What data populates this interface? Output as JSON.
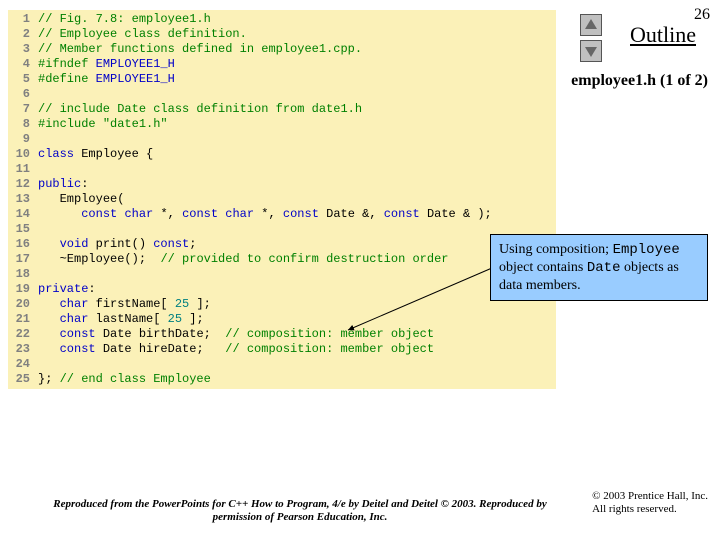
{
  "pageNumber": "26",
  "outline": "Outline",
  "subtitle": "employee1.h (1 of 2)",
  "callout": {
    "t1": "Using composition; ",
    "m1": "Employee",
    "t2": " object contains ",
    "m2": "Date",
    "t3": " objects as data members."
  },
  "copyright": {
    "l1": "© 2003 Prentice Hall, Inc.",
    "l2": "All rights reserved."
  },
  "repro": "Reproduced from the PowerPoints for C++ How to Program, 4/e by Deitel and Deitel © 2003. Reproduced by permission of Pearson Education, Inc.",
  "code": {
    "l1": {
      "n": "1",
      "pad": "",
      "c": "// Fig. 7.8: employee1.h"
    },
    "l2": {
      "n": "2",
      "pad": "",
      "c": "// Employee class definition."
    },
    "l3": {
      "n": "3",
      "pad": "",
      "c": "// Member functions defined in employee1.cpp."
    },
    "l4": {
      "n": "4",
      "pad": "",
      "p1": "#ifndef",
      "sp": " ",
      "id": "EMPLOYEE1_H"
    },
    "l5": {
      "n": "5",
      "pad": "",
      "p1": "#define",
      "sp": " ",
      "id": "EMPLOYEE1_H"
    },
    "l6": {
      "n": "6"
    },
    "l7": {
      "n": "7",
      "pad": "",
      "c": "// include Date class definition from date1.h"
    },
    "l8": {
      "n": "8",
      "pad": "",
      "p1": "#include",
      "sp": " ",
      "s": "\"date1.h\""
    },
    "l9": {
      "n": "9"
    },
    "l10": {
      "n": "10",
      "kw": "class",
      "t": " Employee {"
    },
    "l11": {
      "n": "11"
    },
    "l12": {
      "n": "12",
      "kw": "public",
      "t": ":"
    },
    "l13": {
      "n": "13",
      "pad": "   ",
      "t": "Employee("
    },
    "l14": {
      "n": "14",
      "pad": "      ",
      "k1": "const",
      "t1": " ",
      "k2": "char",
      "t2": " *, ",
      "k3": "const",
      "t3": " ",
      "k4": "char",
      "t4": " *, ",
      "k5": "const",
      "t5": " Date &, ",
      "k6": "const",
      "t6": " Date & );"
    },
    "l15": {
      "n": "15"
    },
    "l16": {
      "n": "16",
      "pad": "   ",
      "k1": "void",
      "t1": " print() ",
      "k2": "const",
      "t2": ";"
    },
    "l17": {
      "n": "17",
      "pad": "   ",
      "t1": "~Employee();  ",
      "c": "// provided to confirm destruction order"
    },
    "l18": {
      "n": "18"
    },
    "l19": {
      "n": "19",
      "kw": "private",
      "t": ":"
    },
    "l20": {
      "n": "20",
      "pad": "   ",
      "k1": "char",
      "t1": " firstName[ ",
      "num": "25",
      "t2": " ];"
    },
    "l21": {
      "n": "21",
      "pad": "   ",
      "k1": "char",
      "t1": " lastName[ ",
      "num": "25",
      "t2": " ];"
    },
    "l22": {
      "n": "22",
      "pad": "   ",
      "k1": "const",
      "t1": " Date birthDate;  ",
      "c": "// composition: member object"
    },
    "l23": {
      "n": "23",
      "pad": "   ",
      "k1": "const",
      "t1": " Date hireDate;   ",
      "c": "// composition: member object"
    },
    "l24": {
      "n": "24"
    },
    "l25": {
      "n": "25",
      "pad": "",
      "t": "}; ",
      "c": "// end class Employee"
    }
  }
}
